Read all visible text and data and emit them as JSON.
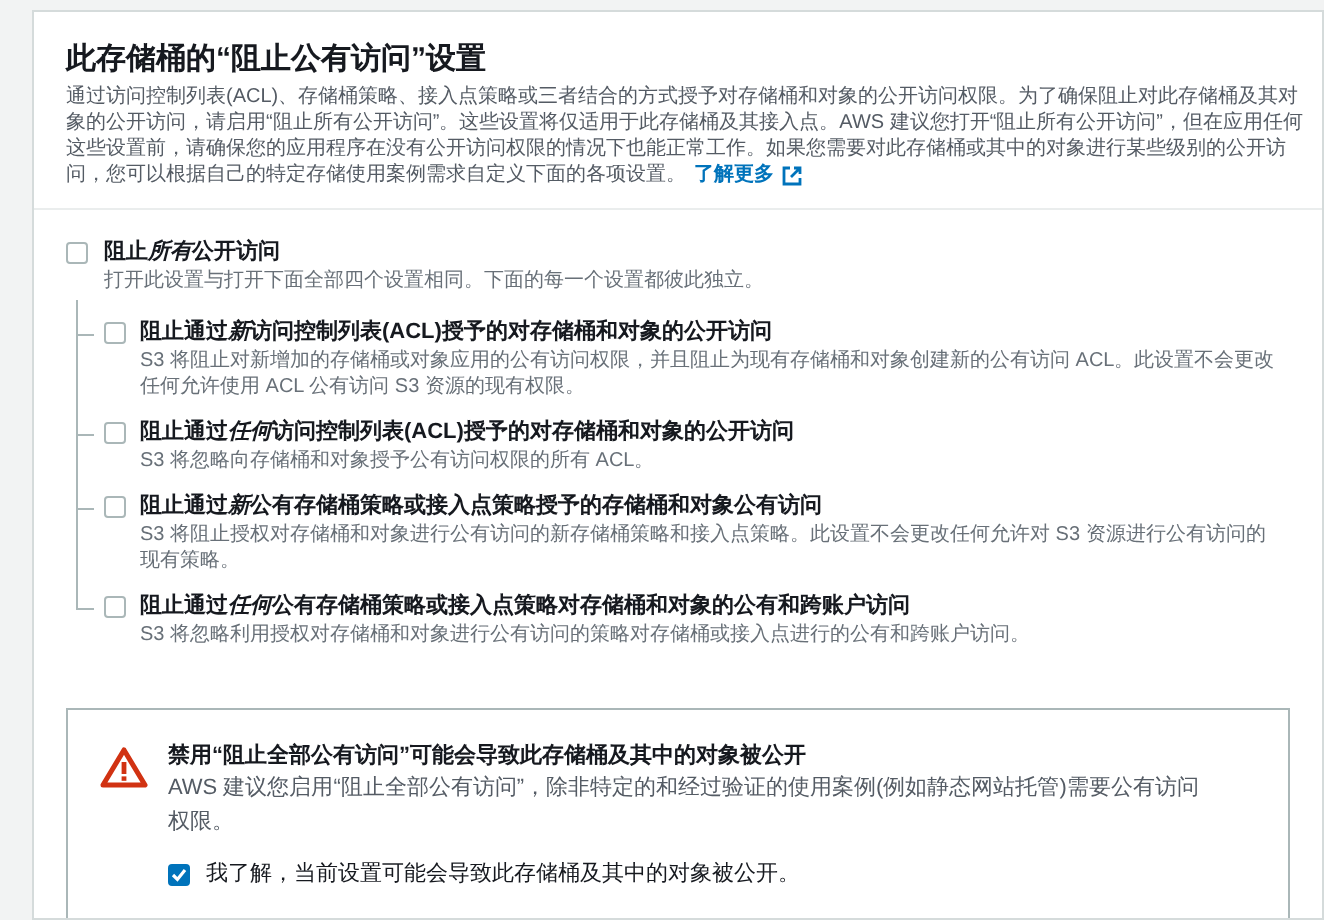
{
  "header": {
    "title": "此存储桶的“阻止公有访问”设置",
    "description": "通过访问控制列表(ACL)、存储桶策略、接入点策略或三者结合的方式授予对存储桶和对象的公开访问权限。为了确保阻止对此存储桶及其对象的公开访问，请启用“阻止所有公开访问”。这些设置将仅适用于此存储桶及其接入点。AWS 建议您打开“阻止所有公开访问”，但在应用任何这些设置前，请确保您的应用程序在没有公开访问权限的情况下也能正常工作。如果您需要对此存储桶或其中的对象进行某些级别的公开访问，您可以根据自己的特定存储使用案例需求自定义下面的各项设置。",
    "link": "了解更多"
  },
  "block_all": {
    "title": [
      {
        "text": "阻止",
        "italic": false
      },
      {
        "text": "所有",
        "italic": true
      },
      {
        "text": "公开访问",
        "italic": false
      }
    ],
    "description": "打开此设置与打开下面全部四个设置相同。下面的每一个设置都彼此独立。",
    "checked": false
  },
  "options": [
    {
      "title": [
        {
          "text": "阻止通过",
          "italic": false
        },
        {
          "text": "新",
          "italic": true
        },
        {
          "text": "访问控制列表(ACL)授予的对存储桶和对象的公开访问",
          "italic": false
        }
      ],
      "description": "S3 将阻止对新增加的存储桶或对象应用的公有访问权限，并且阻止为现有存储桶和对象创建新的公有访问 ACL。此设置不会更改任何允许使用 ACL 公有访问 S3 资源的现有权限。",
      "checked": false
    },
    {
      "title": [
        {
          "text": "阻止通过",
          "italic": false
        },
        {
          "text": "任何",
          "italic": true
        },
        {
          "text": "访问控制列表(ACL)授予的对存储桶和对象的公开访问",
          "italic": false
        }
      ],
      "description": "S3 将忽略向存储桶和对象授予公有访问权限的所有 ACL。",
      "checked": false
    },
    {
      "title": [
        {
          "text": "阻止通过",
          "italic": false
        },
        {
          "text": "新",
          "italic": true
        },
        {
          "text": "公有存储桶策略或接入点策略授予的存储桶和对象公有访问",
          "italic": false
        }
      ],
      "description": "S3 将阻止授权对存储桶和对象进行公有访问的新存储桶策略和接入点策略。此设置不会更改任何允许对 S3 资源进行公有访问的现有策略。",
      "checked": false
    },
    {
      "title": [
        {
          "text": "阻止通过",
          "italic": false
        },
        {
          "text": "任何",
          "italic": true
        },
        {
          "text": "公有存储桶策略或接入点策略对存储桶和对象的公有和跨账户访问",
          "italic": false
        }
      ],
      "description": "S3 将忽略利用授权对存储桶和对象进行公有访问的策略对存储桶或接入点进行的公有和跨账户访问。",
      "checked": false
    }
  ],
  "warning": {
    "title": "禁用“阻止全部公有访问”可能会导致此存储桶及其中的对象被公开",
    "description": "AWS 建议您启用“阻止全部公有访问”，除非特定的和经过验证的使用案例(例如静态网站托管)需要公有访问权限。",
    "acknowledge": {
      "label": "我了解，当前设置可能会导致此存储桶及其中的对象被公开。",
      "checked": true
    }
  }
}
